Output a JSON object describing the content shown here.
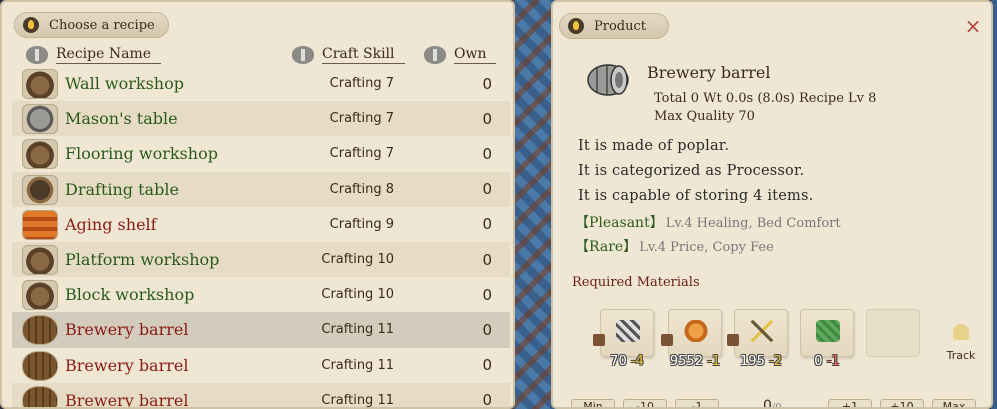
{
  "recipe_panel": {
    "title": "Choose a recipe",
    "columns": {
      "name": "Recipe Name",
      "skill": "Craft Skill",
      "own": "Own"
    },
    "rows": [
      {
        "name": "Wall workshop",
        "skill": "Crafting 7",
        "own": "0",
        "color": "green",
        "icon": "wall-workshop-icon"
      },
      {
        "name": "Mason's table",
        "skill": "Crafting 7",
        "own": "0",
        "color": "green",
        "icon": "masons-table-icon"
      },
      {
        "name": "Flooring workshop",
        "skill": "Crafting 7",
        "own": "0",
        "color": "green",
        "icon": "flooring-workshop-icon"
      },
      {
        "name": "Drafting table",
        "skill": "Crafting 8",
        "own": "0",
        "color": "green",
        "icon": "drafting-table-icon"
      },
      {
        "name": "Aging shelf",
        "skill": "Crafting 9",
        "own": "0",
        "color": "red",
        "icon": "aging-shelf-icon"
      },
      {
        "name": "Platform workshop",
        "skill": "Crafting 10",
        "own": "0",
        "color": "green",
        "icon": "platform-workshop-icon"
      },
      {
        "name": "Block workshop",
        "skill": "Crafting 10",
        "own": "0",
        "color": "green",
        "icon": "block-workshop-icon"
      },
      {
        "name": "Brewery barrel",
        "skill": "Crafting 11",
        "own": "0",
        "color": "red",
        "icon": "brewery-barrel-icon",
        "selected": true
      },
      {
        "name": "Brewery barrel",
        "skill": "Crafting 11",
        "own": "0",
        "color": "red",
        "icon": "brewery-barrel-icon"
      },
      {
        "name": "Brewery barrel",
        "skill": "Crafting 11",
        "own": "0",
        "color": "red",
        "icon": "brewery-barrel-icon"
      }
    ]
  },
  "product_panel": {
    "title": "Product",
    "close_label": "×",
    "name": "Brewery barrel",
    "meta_line1": "Total 0  Wt 0.0s (8.0s)  Recipe Lv 8",
    "meta_line2": "Max Quality 70",
    "description": [
      "It is made of poplar.",
      "It is categorized as Processor.",
      "It is capable of storing 4 items."
    ],
    "traits": [
      {
        "name": "【Pleasant】",
        "value": "Lv.4 Healing, Bed Comfort"
      },
      {
        "name": "【Rare】",
        "value": "Lv.4 Price, Copy Fee"
      }
    ],
    "required_label": "Required Materials",
    "materials": [
      {
        "have": "70",
        "need": "-4",
        "icon": "stone-material-icon"
      },
      {
        "have": "9552",
        "need": "-1",
        "icon": "coil-material-icon"
      },
      {
        "have": "195",
        "need": "-2",
        "icon": "tool-material-icon"
      },
      {
        "have": "0",
        "need": "-1",
        "icon": "green-material-icon"
      }
    ],
    "track_label": "Track",
    "buttons": {
      "min": "Min",
      "minus10": "-10",
      "minus1": "-1",
      "plus1": "+1",
      "plus10": "+10",
      "max": "Max"
    },
    "quantity": "0",
    "quantity_sub": "/0"
  },
  "colors": {
    "panel_bg": "#efe7d4",
    "name_green": "#2a5a1a",
    "name_red": "#8a1a14",
    "selected_row": "#d3cbbc",
    "close_red": "#b0473a"
  }
}
